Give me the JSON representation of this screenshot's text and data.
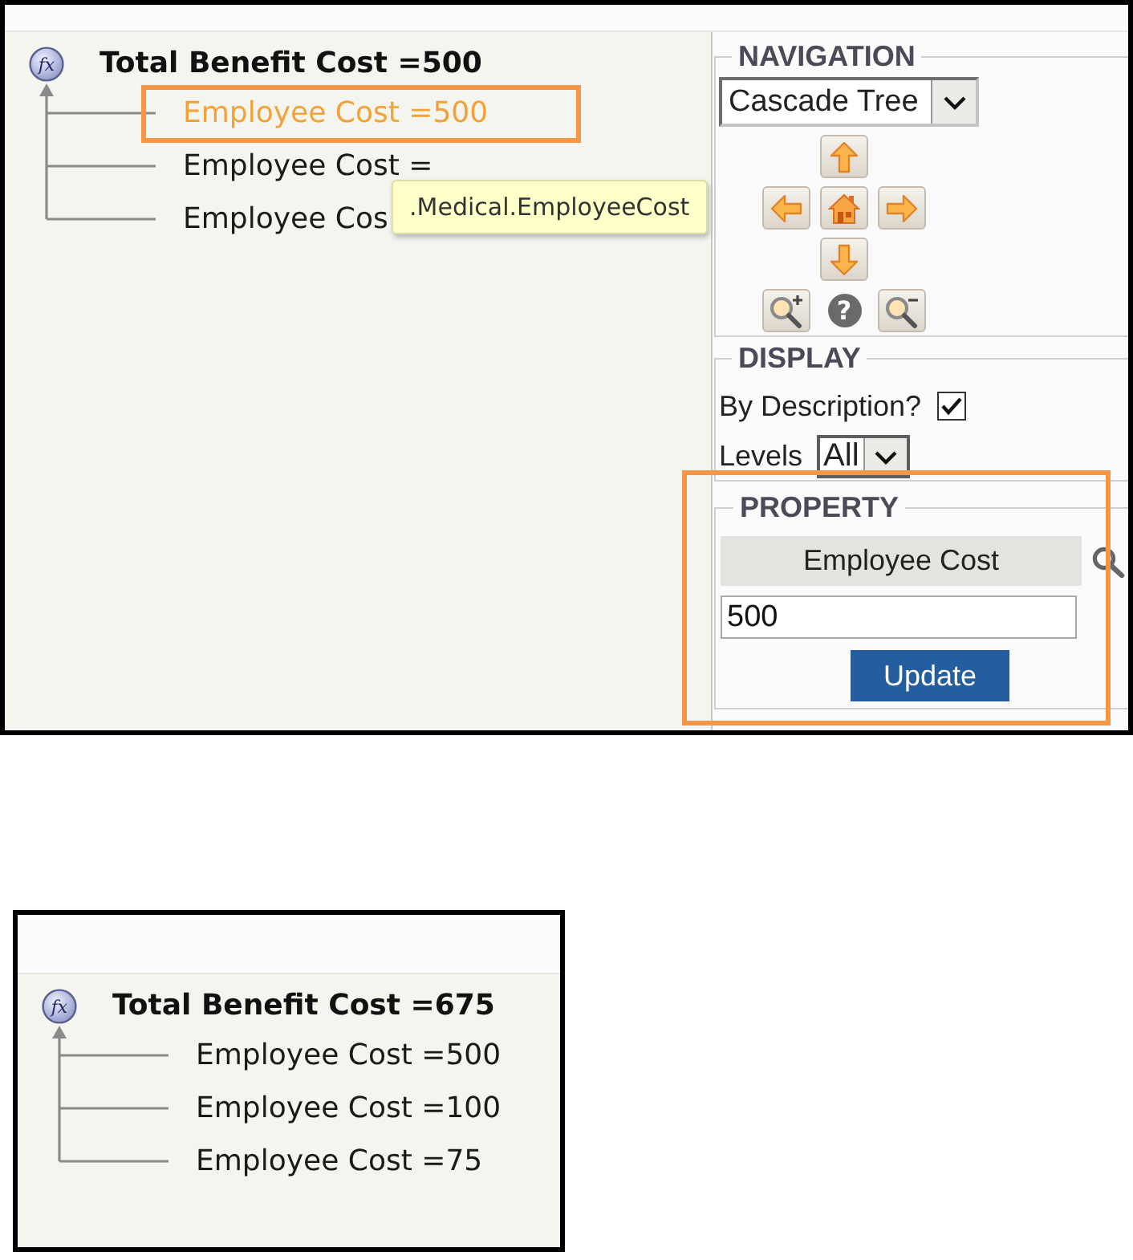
{
  "editor": {
    "tree": {
      "root": {
        "symbol": "fx",
        "label": "Total Benefit Cost =500",
        "children": [
          {
            "label": "Employee Cost =500",
            "selected": true,
            "highlighted": true
          },
          {
            "label": "Employee Cost =",
            "selected": false,
            "highlighted": false
          },
          {
            "label": "Employee Cos",
            "selected": false,
            "highlighted": false
          }
        ]
      }
    },
    "tooltip": ".Medical.EmployeeCost",
    "navigation": {
      "legend": "NAVIGATION",
      "view": "Cascade Tree",
      "help_symbol": "?"
    },
    "display": {
      "legend": "DISPLAY",
      "by_description": {
        "label": "By Description?",
        "checked": true
      },
      "levels": {
        "label": "Levels",
        "value": "All"
      }
    },
    "property": {
      "legend": "PROPERTY",
      "highlighted": true,
      "name": "Employee Cost",
      "value": "500",
      "button": "Update"
    }
  },
  "result": {
    "tree": {
      "root": {
        "symbol": "fx",
        "label": "Total Benefit Cost =675",
        "children": [
          {
            "label": "Employee Cost =500",
            "selected": false,
            "highlighted": false
          },
          {
            "label": "Employee Cost =100",
            "selected": false,
            "highlighted": false
          },
          {
            "label": "Employee Cost =75",
            "selected": false,
            "highlighted": false
          }
        ]
      }
    }
  }
}
